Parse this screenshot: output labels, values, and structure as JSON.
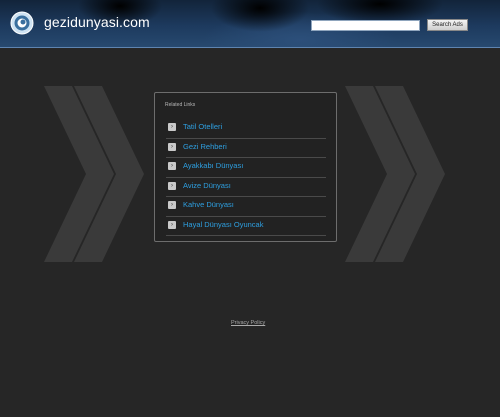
{
  "header": {
    "site_title": "gezidunyasi.com",
    "search_value": "",
    "search_button_label": "Search Ads"
  },
  "related": {
    "title": "Related Links",
    "items": [
      {
        "label": "Tatil Otelleri"
      },
      {
        "label": "Gezi Rehberi"
      },
      {
        "label": "Ayakkabı Dünyası"
      },
      {
        "label": "Avize Dünyası"
      },
      {
        "label": "Kahve Dünyası"
      },
      {
        "label": "Hayal Dünyası Oyuncak"
      }
    ],
    "arrow_glyph": "›"
  },
  "footer": {
    "privacy_label": "Privacy Policy"
  },
  "colors": {
    "link": "#2e9fe0",
    "background": "#262626",
    "header": "#1d3a5e"
  },
  "icons": {
    "logo": "swirl-logo-icon",
    "chevron_left": "chevron-right-icon",
    "chevron_right": "chevron-right-icon"
  }
}
